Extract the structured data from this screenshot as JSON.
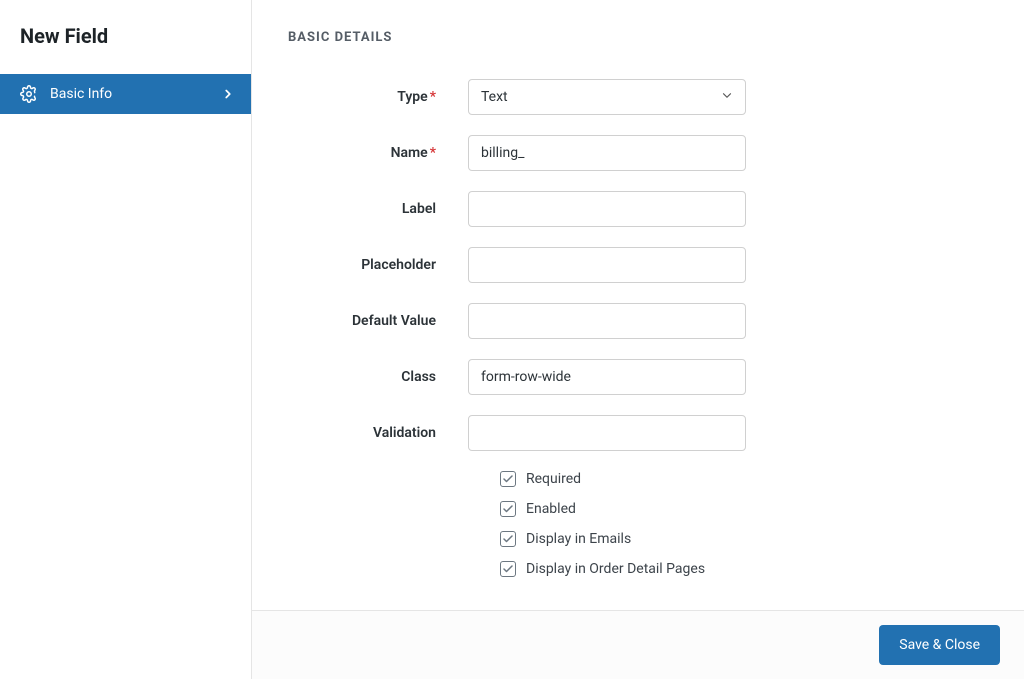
{
  "sidebar": {
    "title": "New Field",
    "item": {
      "label": "Basic Info"
    }
  },
  "section_title": "BASIC DETAILS",
  "fields": {
    "type": {
      "label": "Type",
      "value": "Text"
    },
    "name": {
      "label": "Name",
      "value": "billing_"
    },
    "label": {
      "label": "Label",
      "value": ""
    },
    "placeholder": {
      "label": "Placeholder",
      "value": ""
    },
    "default_value": {
      "label": "Default Value",
      "value": ""
    },
    "class": {
      "label": "Class",
      "value": "form-row-wide"
    },
    "validation": {
      "label": "Validation",
      "value": ""
    }
  },
  "checkboxes": {
    "required": {
      "label": "Required",
      "checked": true
    },
    "enabled": {
      "label": "Enabled",
      "checked": true
    },
    "display_emails": {
      "label": "Display in Emails",
      "checked": true
    },
    "display_order": {
      "label": "Display in Order Detail Pages",
      "checked": true
    }
  },
  "save_button": "Save & Close",
  "required_marker": "*"
}
